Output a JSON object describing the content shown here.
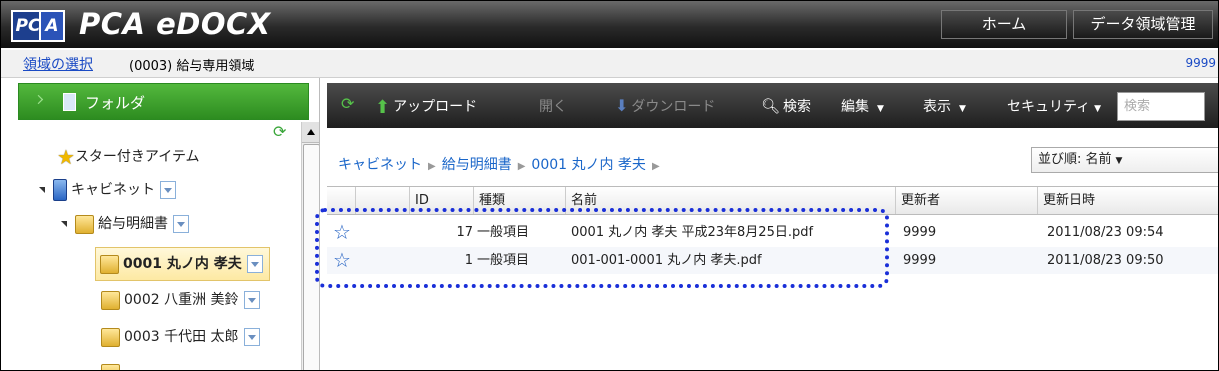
{
  "header": {
    "logo_mark_left": "PC",
    "logo_mark_right": "A",
    "app_title": "PCA eDOCX",
    "home_label": "ホーム",
    "data_area_label": "データ領域管理"
  },
  "area_bar": {
    "select_link": "領域の選択",
    "current_area": "(0003) 給与専用領域",
    "user_code": "9999"
  },
  "sidebar": {
    "folder_header": "フォルダ",
    "items": [
      {
        "label": "スター付きアイテム"
      },
      {
        "label": "キャビネット"
      },
      {
        "label": "給与明細書"
      },
      {
        "label": "0001 丸ノ内 孝夫"
      },
      {
        "label": "0002 八重洲 美鈴"
      },
      {
        "label": "0003 千代田 太郎"
      }
    ]
  },
  "toolbar": {
    "upload": "アップロード",
    "open": "開く",
    "download": "ダウンロード",
    "search": "検索",
    "edit": "編集",
    "view": "表示",
    "security": "セキュリティ",
    "search_placeholder": "検索"
  },
  "breadcrumb": [
    "キャビネット",
    "給与明細書",
    "0001 丸ノ内 孝夫"
  ],
  "sort": {
    "label": "並び順: 名前"
  },
  "table": {
    "columns": [
      "ID",
      "種類",
      "名前",
      "更新者",
      "更新日時"
    ],
    "rows": [
      {
        "id": "17",
        "type": "一般項目",
        "name": "0001 丸ノ内 孝夫 平成23年8月25日.pdf",
        "updater": "9999",
        "updated": "2011/08/23 09:54"
      },
      {
        "id": "1",
        "type": "一般項目",
        "name": "001-001-0001 丸ノ内 孝夫.pdf",
        "updater": "9999",
        "updated": "2011/08/23 09:50"
      }
    ]
  },
  "colors": {
    "accent_green": "#2d8c20",
    "link_blue": "#1a66c9",
    "highlight_dotted": "#1a2fd8"
  }
}
